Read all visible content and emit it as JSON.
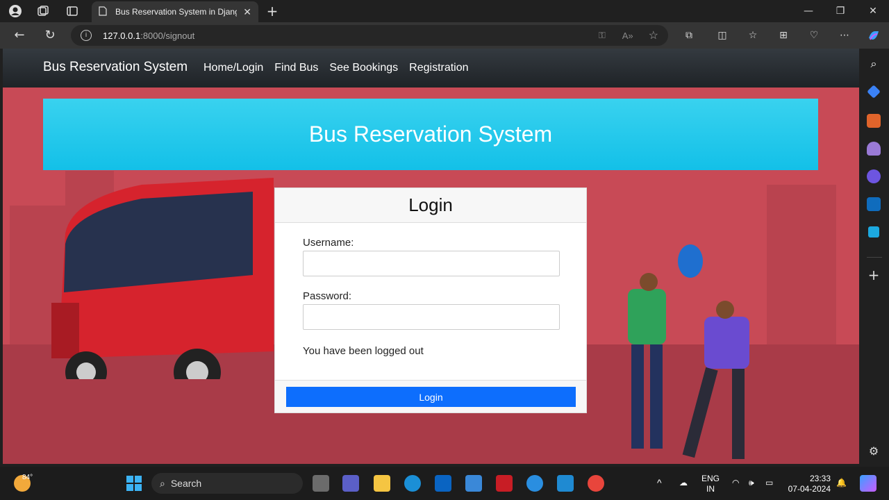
{
  "browser": {
    "tab_title": "Bus Reservation System in Djang",
    "url_host": "127.0.0.1",
    "url_path": ":8000/signout"
  },
  "navbar": {
    "brand": "Bus Reservation System",
    "links": [
      "Home/Login",
      "Find Bus",
      "See Bookings",
      "Registration"
    ]
  },
  "hero": {
    "title": "Bus Reservation System"
  },
  "login": {
    "heading": "Login",
    "username_label": "Username:",
    "password_label": "Password:",
    "message": "You have been logged out",
    "button": "Login"
  },
  "taskbar": {
    "weather_temp": "84°",
    "search_label": "Search",
    "lang_line1": "ENG",
    "lang_line2": "IN",
    "time": "23:33",
    "date": "07-04-2024"
  },
  "colors": {
    "accent": "#0d6efd",
    "hero": "#1ec6ec",
    "background": "#c94b56"
  }
}
